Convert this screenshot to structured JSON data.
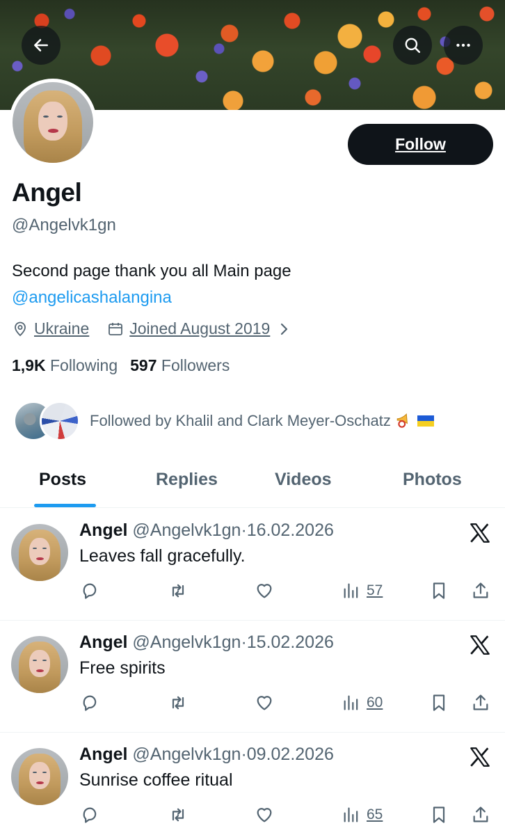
{
  "header": {
    "back_icon": "arrow-left-icon",
    "search_icon": "search-icon",
    "more_icon": "more-horizontal-icon",
    "follow_label": "Follow"
  },
  "profile": {
    "name": "Angel",
    "handle": "@Angelvk1gn",
    "bio_text": "Second page thank you all Main page",
    "bio_link": "@angelicashalangina",
    "location": "Ukraine",
    "joined": "Joined August 2019",
    "following_count": "1,9K",
    "following_label": "Following",
    "followers_count": "597",
    "followers_label": "Followers",
    "followed_by": "Followed by Khalil and Clark Meyer-Oschatz"
  },
  "tabs": [
    {
      "label": "Posts",
      "active": true
    },
    {
      "label": "Replies",
      "active": false
    },
    {
      "label": "Videos",
      "active": false
    },
    {
      "label": "Photos",
      "active": false
    }
  ],
  "tweets": [
    {
      "name": "Angel",
      "handle": "@Angelvk1gn",
      "sep": "·",
      "date": "16.02.2026",
      "text": "Leaves fall gracefully.",
      "views": "57"
    },
    {
      "name": "Angel",
      "handle": "@Angelvk1gn",
      "sep": "·",
      "date": "15.02.2026",
      "text": "Free spirits",
      "views": "60"
    },
    {
      "name": "Angel",
      "handle": "@Angelvk1gn",
      "sep": "·",
      "date": "09.02.2026",
      "text": "Sunrise coffee ritual",
      "views": "65"
    }
  ],
  "colors": {
    "accent": "#1d9bf0",
    "text": "#0f1419",
    "muted": "#536471"
  }
}
